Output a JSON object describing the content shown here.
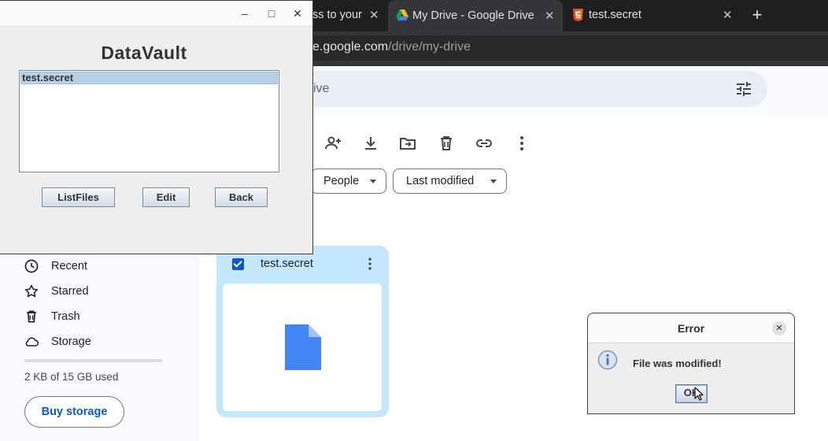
{
  "browser": {
    "tabs": [
      {
        "label": "ss to your",
        "active": false
      },
      {
        "label": "My Drive - Google Drive",
        "active": true
      },
      {
        "label": "test.secret",
        "active": false
      }
    ],
    "url_host": "e.google.com",
    "url_path": "/drive/my-drive"
  },
  "drive": {
    "search_placeholder": "ive",
    "filters": [
      {
        "label": "People"
      },
      {
        "label": "Last modified"
      }
    ],
    "sidebar": [
      {
        "label": "Recent",
        "icon": "clock-icon"
      },
      {
        "label": "Starred",
        "icon": "star-icon"
      },
      {
        "label": "Trash",
        "icon": "trash-icon"
      },
      {
        "label": "Storage",
        "icon": "cloud-icon"
      }
    ],
    "storage_used_fraction": 0.0001,
    "storage_text": "2 KB of 15 GB used",
    "buy_storage_label": "Buy storage",
    "file": {
      "name": "test.secret",
      "selected": true
    }
  },
  "datavault": {
    "title": "DataVault",
    "files": [
      "test.secret"
    ],
    "buttons": {
      "list": "ListFiles",
      "edit": "Edit",
      "back": "Back"
    },
    "window_controls": {
      "minimize": "–",
      "maximize": "□",
      "close": "✕"
    }
  },
  "error_dialog": {
    "title": "Error",
    "message": "File was modified!",
    "ok_label": "OK",
    "close_glyph": "✕"
  },
  "colors": {
    "drive_accent": "#0b57d0",
    "card_selected": "#c2e7ff",
    "doc_icon": "#4285f4"
  }
}
